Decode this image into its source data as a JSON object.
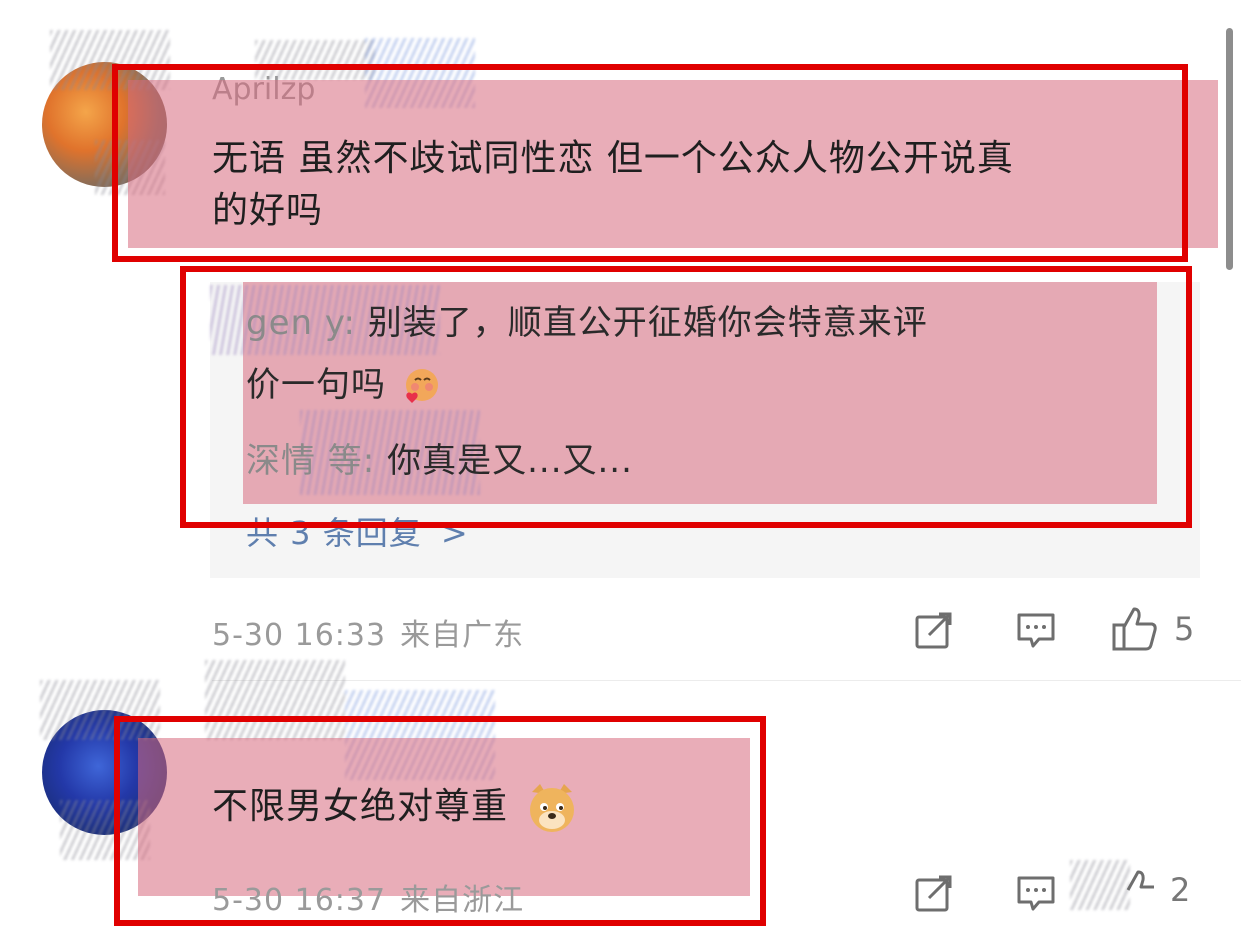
{
  "comments": [
    {
      "username": "Aprilzp",
      "text_line1": "无语 虽然不歧试同性恋 但一个公众人物公开说真",
      "text_line2": "的好吗",
      "replies": [
        {
          "user": "gen    y:",
          "text_line1": "别装了，顺直公开征婚你会特意来评",
          "text_line2": "价一句吗",
          "emoji": "blush-heart-emoji"
        },
        {
          "user": "深情    等:",
          "text": "你真是又...又..."
        }
      ],
      "more_replies_label": "共 3 条回复",
      "more_replies_chevron": ">",
      "date": "5-30 16:33",
      "location": "来自广东",
      "like_count": "5"
    },
    {
      "username": "",
      "text": "不限男女绝对尊重",
      "emoji": "doge-emoji",
      "date": "5-30 16:37",
      "location": "来自浙江",
      "like_count": "2"
    }
  ],
  "colors": {
    "highlight": "#d7697d",
    "frame": "#e00000",
    "link": "#5f7fae",
    "meta": "#9a9a9a"
  }
}
